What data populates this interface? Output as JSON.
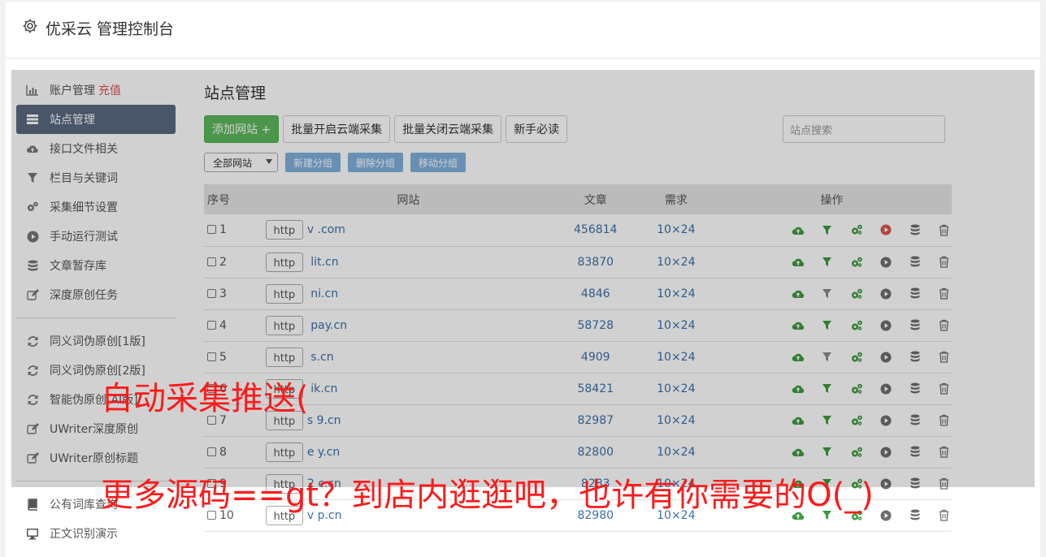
{
  "app": {
    "title": "优采云 管理控制台"
  },
  "sidebar": {
    "items": [
      {
        "label": "账户管理",
        "extra": "充值",
        "icon": "bar-chart-icon"
      },
      {
        "label": "站点管理",
        "icon": "list-icon",
        "active": true
      },
      {
        "label": "接口文件相关",
        "icon": "cloud-upload-icon"
      },
      {
        "label": "栏目与关键词",
        "icon": "filter-icon"
      },
      {
        "label": "采集细节设置",
        "icon": "cogs-icon"
      },
      {
        "label": "手动运行测试",
        "icon": "play-circle-icon"
      },
      {
        "label": "文章暂存库",
        "icon": "database-icon"
      },
      {
        "label": "深度原创任务",
        "icon": "edit-icon"
      }
    ],
    "group2": [
      {
        "label": "同义词伪原创[1版]",
        "icon": "refresh-icon"
      },
      {
        "label": "同义词伪原创[2版]",
        "icon": "refresh-icon"
      },
      {
        "label": "智能伪原创[AI版]",
        "icon": "refresh-icon"
      },
      {
        "label": "UWriter深度原创",
        "icon": "edit-icon"
      },
      {
        "label": "UWriter原创标题",
        "icon": "edit-icon"
      }
    ],
    "group3": [
      {
        "label": "公有词库查询",
        "icon": "book-icon"
      },
      {
        "label": "正文识别演示",
        "icon": "monitor-icon"
      }
    ]
  },
  "main": {
    "title": "站点管理",
    "toolbar": {
      "add": "添加网站 +",
      "batch_on": "批量开启云端采集",
      "batch_off": "批量关闭云端采集",
      "guide": "新手必读"
    },
    "search_placeholder": "站点搜索",
    "filter": {
      "select_value": "全部网站",
      "new_group": "新建分组",
      "delete_group": "删除分组",
      "move_group": "移动分组"
    },
    "table": {
      "headers": {
        "no": "序号",
        "site": "网站",
        "articles": "文章",
        "demand": "需求",
        "ops": "操作"
      },
      "rows": [
        {
          "no": "1",
          "scheme": "http",
          "domain": "v          .com",
          "articles": "456814",
          "demand": "10×24",
          "filter_on": true,
          "play_red": true
        },
        {
          "no": "2",
          "scheme": "http",
          "domain": "    lit.cn",
          "articles": "83870",
          "demand": "10×24",
          "filter_on": true,
          "play_red": false
        },
        {
          "no": "3",
          "scheme": "http",
          "domain": "    ni.cn",
          "articles": "4846",
          "demand": "10×24",
          "filter_on": false,
          "play_red": false
        },
        {
          "no": "4",
          "scheme": "http",
          "domain": "      pay.cn",
          "articles": "58728",
          "demand": "10×24",
          "filter_on": true,
          "play_red": false
        },
        {
          "no": "5",
          "scheme": "http",
          "domain": "      s.cn",
          "articles": "4909",
          "demand": "10×24",
          "filter_on": false,
          "play_red": false
        },
        {
          "no": "6",
          "scheme": "http",
          "domain": "    ik.cn",
          "articles": "58421",
          "demand": "10×24",
          "filter_on": true,
          "play_red": false
        },
        {
          "no": "7",
          "scheme": "http",
          "domain": "s   9.cn",
          "articles": "82987",
          "demand": "10×24",
          "filter_on": true,
          "play_red": false
        },
        {
          "no": "8",
          "scheme": "http",
          "domain": "e    y.cn",
          "articles": "82800",
          "demand": "10×24",
          "filter_on": true,
          "play_red": false
        },
        {
          "no": "9",
          "scheme": "http",
          "domain": "2    c.cn",
          "articles": "8283",
          "demand": "10×24",
          "filter_on": true,
          "play_red": false
        },
        {
          "no": "10",
          "scheme": "http",
          "domain": "v    p.cn",
          "articles": "82980",
          "demand": "10×24",
          "filter_on": true,
          "play_red": false
        }
      ]
    }
  },
  "watermark": {
    "line1": "自动采集推送(",
    "line2": "更多源码==gt？到店内逛逛吧，也许有你需要的O(_)"
  },
  "colors": {
    "green": "#3c9a3c",
    "red": "#d9534f",
    "link": "#3a6fa8",
    "active_nav": "#5a6a80",
    "watermark": "#ff1a1a"
  }
}
